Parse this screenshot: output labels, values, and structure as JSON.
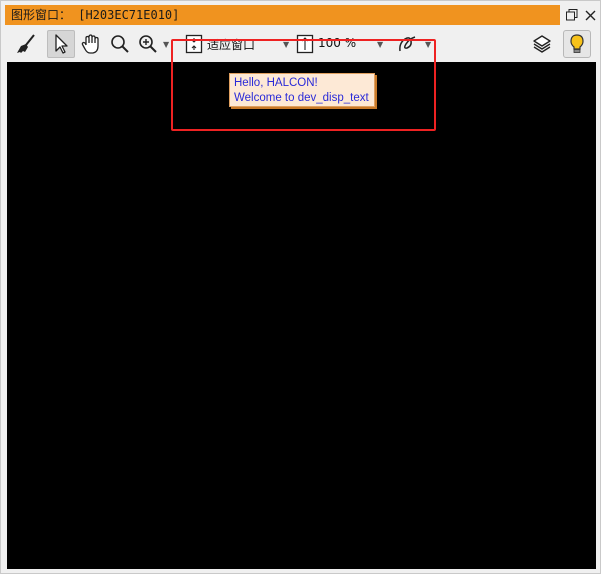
{
  "window": {
    "title": "图形窗口： [H203EC71E010]",
    "restore_icon": "restore-window-icon",
    "close_icon": "close-icon"
  },
  "toolbar": {
    "clear_icon": "broom-icon",
    "pointer_icon": "pointer-icon",
    "pan_icon": "hand-icon",
    "magnify_icon": "magnifier-icon",
    "zoom_icon": "zoom-in-icon",
    "fit_label": "适应窗口",
    "zoom_level": "100 %",
    "draw_icon": "freehand-draw-icon",
    "layers_icon": "layers-icon",
    "bulb_icon": "lightbulb-icon"
  },
  "canvas": {
    "background": "#000000",
    "overlay_text": {
      "line1": "Hello, HALCON!",
      "line2": "Welcome to dev_disp_text"
    }
  },
  "colors": {
    "title_bar": "#f0931f",
    "overlay_bg": "#fde9d6",
    "overlay_text": "#2a2ad8",
    "annotation_box": "#ee2222"
  }
}
